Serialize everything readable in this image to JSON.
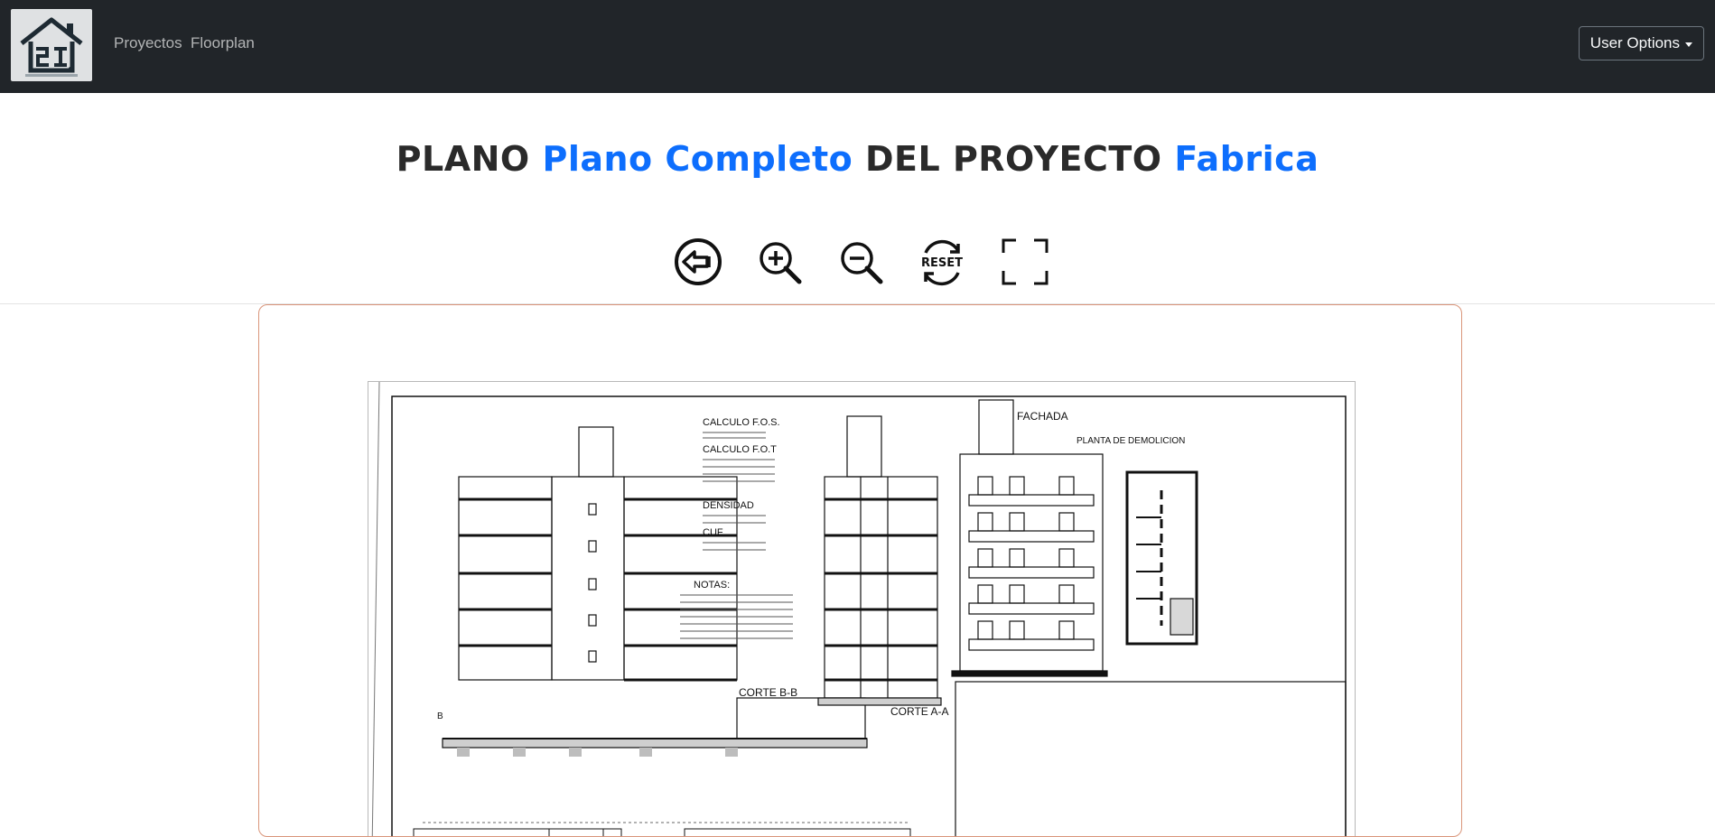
{
  "navbar": {
    "links": [
      "Proyectos",
      "Floorplan"
    ],
    "user_options_label": "User Options"
  },
  "header": {
    "title_prefix": "PLANO",
    "plan_name": "Plano Completo",
    "title_middle": "DEL PROYECTO",
    "project_name": "Fabrica"
  },
  "toolbar": {
    "reset_label": "RESET"
  },
  "plan_drawing": {
    "fachada": "FACHADA",
    "planta_demolicion": "PLANTA DE DEMOLICION",
    "corte_bb": "CORTE B-B",
    "corte_aa": "CORTE A-A",
    "calculo_fos": "CALCULO F.O.S.",
    "calculo_fot": "CALCULO F.O.T",
    "densidad": "DENSIDAD",
    "cuf": "CUF",
    "notas": "NOTAS:",
    "fragment_b": "B"
  },
  "colors": {
    "navbar_bg": "#212529",
    "accent": "#0d6efd",
    "viewer_border": "#d9957a"
  },
  "icons": [
    "house-logo-icon",
    "back-arrow-icon",
    "zoom-in-icon",
    "zoom-out-icon",
    "reset-icon",
    "fullscreen-icon"
  ]
}
